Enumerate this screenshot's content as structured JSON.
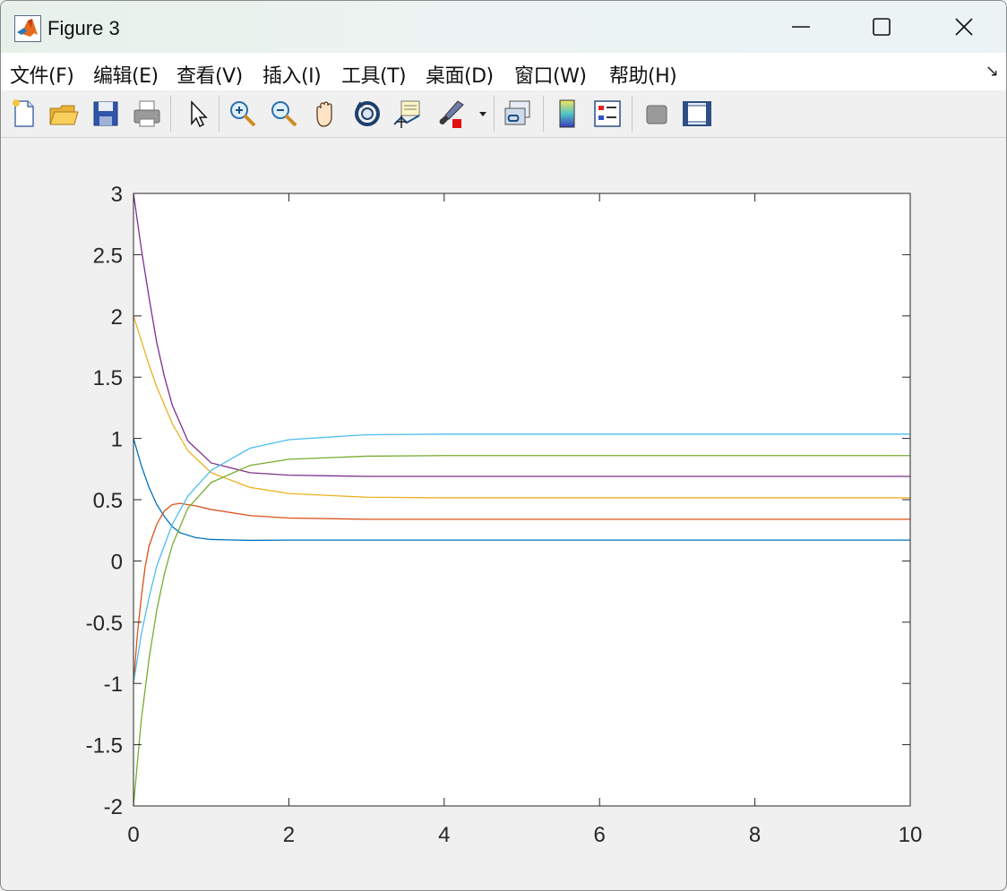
{
  "window": {
    "title": "Figure 3"
  },
  "menu": {
    "items": [
      "文件(F)",
      "编辑(E)",
      "查看(V)",
      "插入(I)",
      "工具(T)",
      "桌面(D)",
      "窗口(W)",
      "帮助(H)"
    ]
  },
  "toolbar": {
    "icons": [
      "new-figure-icon",
      "open-file-icon",
      "save-icon",
      "print-icon",
      "select-pointer-icon",
      "zoom-in-icon",
      "zoom-out-icon",
      "pan-hand-icon",
      "rotate-3d-icon",
      "data-cursor-icon",
      "brush-icon",
      "link-plot-icon",
      "colorbar-icon",
      "legend-icon",
      "hide-plot-tools-icon",
      "show-plot-tools-icon"
    ]
  },
  "chart_data": {
    "type": "line",
    "xlim": [
      0,
      10
    ],
    "ylim": [
      -2,
      3
    ],
    "xticks": [
      "0",
      "2",
      "4",
      "6",
      "8",
      "10"
    ],
    "yticks": [
      "3",
      "2.5",
      "2",
      "1.5",
      "1",
      "0.5",
      "0",
      "-0.5",
      "-1",
      "-1.5",
      "-2"
    ],
    "grid": false,
    "series": [
      {
        "color": "#0072BD",
        "points": [
          [
            0,
            1
          ],
          [
            0.1,
            0.78
          ],
          [
            0.2,
            0.6
          ],
          [
            0.3,
            0.46
          ],
          [
            0.4,
            0.36
          ],
          [
            0.5,
            0.28
          ],
          [
            0.6,
            0.23
          ],
          [
            0.8,
            0.19
          ],
          [
            1,
            0.175
          ],
          [
            1.5,
            0.168
          ],
          [
            2,
            0.17
          ],
          [
            3,
            0.17
          ],
          [
            10,
            0.17
          ]
        ]
      },
      {
        "color": "#D95319",
        "points": [
          [
            0,
            -1
          ],
          [
            0.05,
            -0.6
          ],
          [
            0.1,
            -0.3
          ],
          [
            0.15,
            -0.05
          ],
          [
            0.2,
            0.12
          ],
          [
            0.3,
            0.3
          ],
          [
            0.4,
            0.41
          ],
          [
            0.5,
            0.46
          ],
          [
            0.6,
            0.47
          ],
          [
            0.8,
            0.45
          ],
          [
            1,
            0.42
          ],
          [
            1.5,
            0.37
          ],
          [
            2,
            0.35
          ],
          [
            3,
            0.34
          ],
          [
            10,
            0.34
          ]
        ]
      },
      {
        "color": "#EDB120",
        "points": [
          [
            0,
            2
          ],
          [
            0.1,
            1.8
          ],
          [
            0.2,
            1.6
          ],
          [
            0.3,
            1.42
          ],
          [
            0.5,
            1.12
          ],
          [
            0.7,
            0.9
          ],
          [
            1,
            0.72
          ],
          [
            1.5,
            0.6
          ],
          [
            2,
            0.55
          ],
          [
            3,
            0.52
          ],
          [
            4,
            0.515
          ],
          [
            10,
            0.515
          ]
        ]
      },
      {
        "color": "#7E2F8E",
        "points": [
          [
            0,
            3
          ],
          [
            0.1,
            2.55
          ],
          [
            0.2,
            2.15
          ],
          [
            0.3,
            1.78
          ],
          [
            0.4,
            1.5
          ],
          [
            0.5,
            1.27
          ],
          [
            0.7,
            0.98
          ],
          [
            1,
            0.8
          ],
          [
            1.5,
            0.72
          ],
          [
            2,
            0.7
          ],
          [
            3,
            0.69
          ],
          [
            10,
            0.69
          ]
        ]
      },
      {
        "color": "#77AC30",
        "points": [
          [
            0,
            -2
          ],
          [
            0.1,
            -1.3
          ],
          [
            0.2,
            -0.8
          ],
          [
            0.3,
            -0.4
          ],
          [
            0.4,
            -0.1
          ],
          [
            0.5,
            0.13
          ],
          [
            0.7,
            0.43
          ],
          [
            1,
            0.64
          ],
          [
            1.5,
            0.78
          ],
          [
            2,
            0.83
          ],
          [
            3,
            0.855
          ],
          [
            4,
            0.86
          ],
          [
            10,
            0.86
          ]
        ]
      },
      {
        "color": "#4DBEEE",
        "points": [
          [
            0,
            -1
          ],
          [
            0.1,
            -0.6
          ],
          [
            0.2,
            -0.3
          ],
          [
            0.3,
            -0.04
          ],
          [
            0.5,
            0.3
          ],
          [
            0.7,
            0.53
          ],
          [
            1,
            0.74
          ],
          [
            1.5,
            0.92
          ],
          [
            2,
            0.99
          ],
          [
            3,
            1.03
          ],
          [
            4,
            1.035
          ],
          [
            10,
            1.035
          ]
        ]
      }
    ]
  }
}
